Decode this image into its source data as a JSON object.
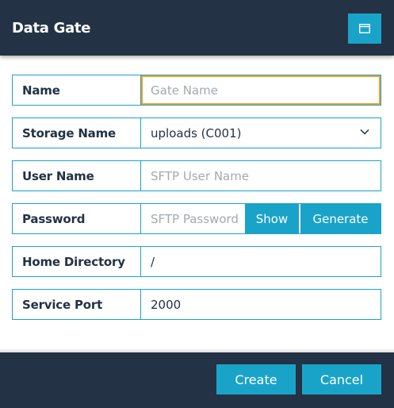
{
  "header": {
    "title": "Data Gate",
    "window_icon": "window-restore-icon"
  },
  "form": {
    "name": {
      "label": "Name",
      "value": "",
      "placeholder": "Gate Name"
    },
    "storage_name": {
      "label": "Storage Name",
      "value": "uploads (C001)",
      "icon": "chevron-down-icon"
    },
    "user_name": {
      "label": "User Name",
      "value": "",
      "placeholder": "SFTP User Name"
    },
    "password": {
      "label": "Password",
      "value": "",
      "placeholder": "SFTP Password",
      "show_label": "Show",
      "generate_label": "Generate"
    },
    "home_directory": {
      "label": "Home Directory",
      "value": "/"
    },
    "service_port": {
      "label": "Service Port",
      "value": "2000"
    }
  },
  "footer": {
    "create_label": "Create",
    "cancel_label": "Cancel"
  },
  "colors": {
    "header_bg": "#233244",
    "accent": "#1aa3c9",
    "focus": "#f0a024",
    "text": "#233244"
  }
}
